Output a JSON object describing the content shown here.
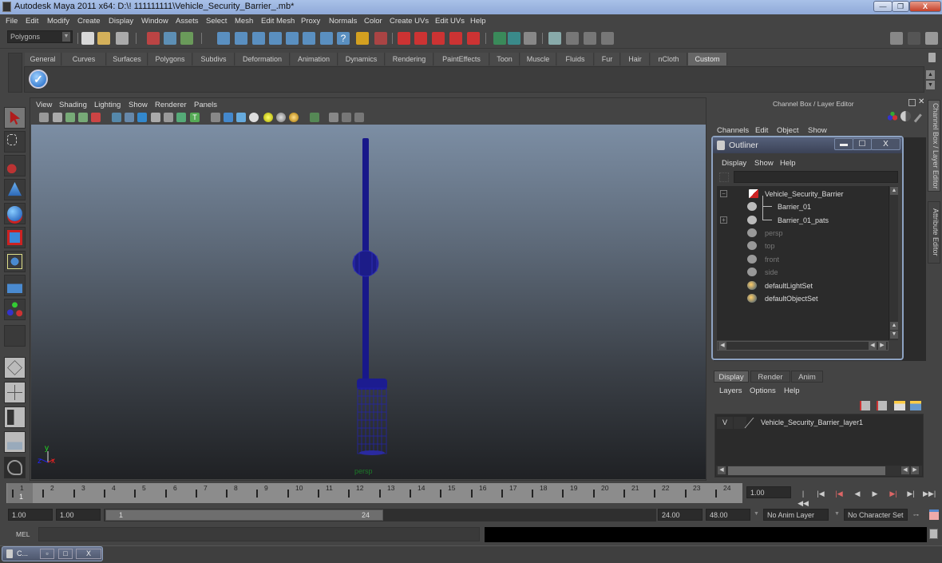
{
  "window": {
    "title": "Autodesk Maya 2011 x64: D:\\! 111111111\\Vehicle_Security_Barrier_.mb*",
    "minimize_label": "—",
    "maximize_label": "❐",
    "close_label": "X"
  },
  "menubar": [
    "File",
    "Edit",
    "Modify",
    "Create",
    "Display",
    "Window",
    "Assets",
    "Select",
    "Mesh",
    "Edit Mesh",
    "Proxy",
    "Normals",
    "Color",
    "Create UVs",
    "Edit UVs",
    "Help"
  ],
  "statusline": {
    "mode": "Polygons",
    "icons": [
      "new-scene",
      "open-scene",
      "save-scene",
      "select-by-hierarchy",
      "select-by-object",
      "select-by-component",
      "snap-grid",
      "snap-curve",
      "snap-point",
      "snap-view-plane",
      "snap-live",
      "help",
      "lock",
      "select-mask",
      "magnet-1",
      "magnet-2",
      "magnet-3",
      "magnet-4",
      "magnet-5",
      "input-ops",
      "output-ops",
      "construction-history",
      "render-frame",
      "ipr-render",
      "render-settings",
      "hypershade",
      "show-attribute-editor",
      "show-tool-settings",
      "show-channel-box"
    ]
  },
  "shelf": {
    "tabs": [
      "General",
      "Curves",
      "Surfaces",
      "Polygons",
      "Subdivs",
      "Deformation",
      "Animation",
      "Dynamics",
      "Rendering",
      "PaintEffects",
      "Toon",
      "Muscle",
      "Fluids",
      "Fur",
      "Hair",
      "nCloth",
      "Custom"
    ],
    "active_tab": "Custom",
    "buttons": [
      "checkmark"
    ]
  },
  "toolbox": {
    "tools": [
      "select-tool",
      "lasso-tool",
      "paint-select-tool",
      "soft-modification-tool",
      "move-tool",
      "rotate-tool",
      "scale-tool",
      "universal-manipulator",
      "show-manipulator",
      "last-tool-used"
    ],
    "layouts": [
      "single-perspective-view",
      "four-view",
      "persp-outliner",
      "persp-graph"
    ],
    "selected": "select-tool"
  },
  "viewport": {
    "menu": [
      "View",
      "Shading",
      "Lighting",
      "Show",
      "Renderer",
      "Panels"
    ],
    "camera_label": "persp",
    "axis": {
      "x": "x",
      "y": "y",
      "z": "z"
    },
    "object_color": "#1a1a8c"
  },
  "channel_box": {
    "title": "Channel Box / Layer Editor",
    "menu": [
      "Channels",
      "Edit",
      "Object",
      "Show"
    ]
  },
  "side_tabs": [
    "Channel Box / Layer Editor",
    "Attribute Editor"
  ],
  "outliner": {
    "title": "Outliner",
    "min_label": "▬",
    "max_label": "☐",
    "close_label": "X",
    "menu": [
      "Display",
      "Show",
      "Help"
    ],
    "items": [
      {
        "label": "Vehicle_Security_Barrier",
        "type": "group",
        "expander": "−",
        "level": 0
      },
      {
        "label": "Barrier_01",
        "type": "mesh",
        "level": 1
      },
      {
        "label": "Barrier_01_pats",
        "type": "mesh",
        "expander": "+",
        "level": 1
      },
      {
        "label": "persp",
        "type": "camera",
        "dim": true,
        "level": 0
      },
      {
        "label": "top",
        "type": "camera",
        "dim": true,
        "level": 0
      },
      {
        "label": "front",
        "type": "camera",
        "dim": true,
        "level": 0
      },
      {
        "label": "side",
        "type": "camera",
        "dim": true,
        "level": 0
      },
      {
        "label": "defaultLightSet",
        "type": "set",
        "level": 0
      },
      {
        "label": "defaultObjectSet",
        "type": "set",
        "level": 0
      }
    ]
  },
  "layer_editor": {
    "tabs": [
      "Display",
      "Render",
      "Anim"
    ],
    "active_tab": "Display",
    "menu": [
      "Layers",
      "Options",
      "Help"
    ],
    "layers": [
      {
        "visible": "V",
        "name": "Vehicle_Security_Barrier_layer1"
      }
    ]
  },
  "timeline": {
    "ticks": [
      "1",
      "2",
      "3",
      "4",
      "5",
      "6",
      "7",
      "8",
      "9",
      "10",
      "11",
      "12",
      "13",
      "14",
      "15",
      "16",
      "17",
      "18",
      "19",
      "20",
      "21",
      "22",
      "23",
      "24"
    ],
    "current_frame": "1",
    "current_time_field": "1.00",
    "playback": [
      "go-to-start",
      "step-back-key",
      "step-back-frame",
      "play-backward",
      "play-forward",
      "step-forward-frame",
      "step-forward-key",
      "go-to-end"
    ]
  },
  "range": {
    "start_time": "1.00",
    "playback_start": "1.00",
    "slider_start": "1",
    "slider_end": "24",
    "playback_end": "24.00",
    "end_time": "48.00",
    "anim_layer": "No Anim Layer",
    "character_set": "No Character Set"
  },
  "command_line": {
    "label": "MEL",
    "input": "",
    "output": ""
  },
  "minimized_window": {
    "label": "C..."
  }
}
